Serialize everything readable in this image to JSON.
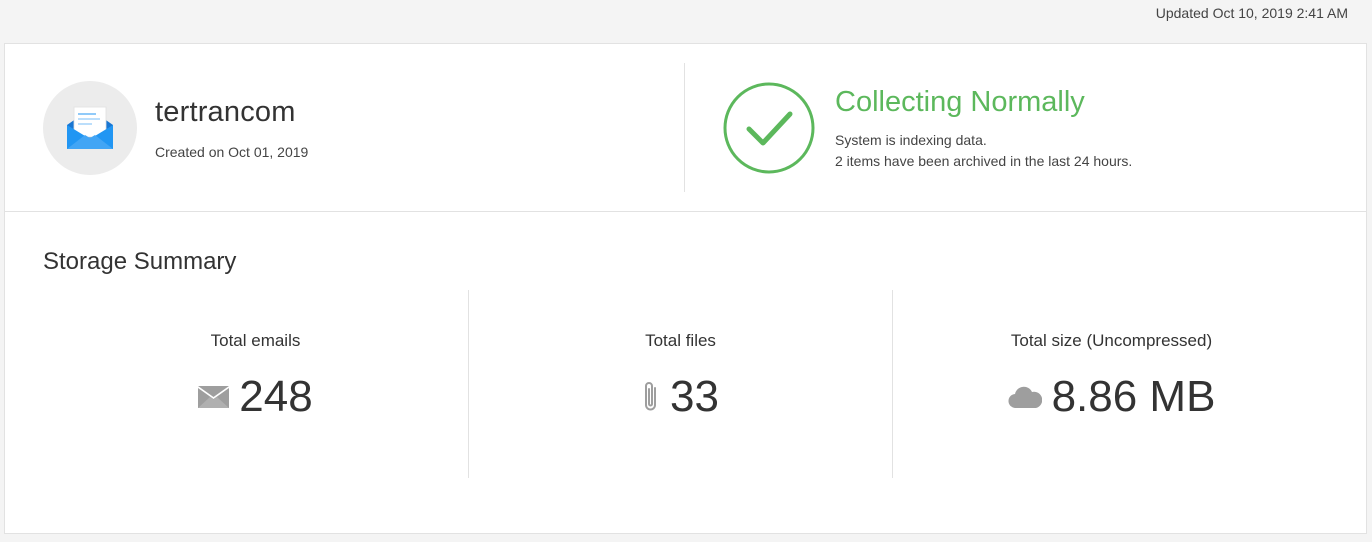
{
  "header": {
    "updated_text": "Updated Oct 10, 2019 2:41 AM"
  },
  "account": {
    "avatar_icon": "open-envelope-icon",
    "name": "tertrancom",
    "created_text": "Created on Oct 01, 2019"
  },
  "status": {
    "icon": "check-circle-icon",
    "title": "Collecting Normally",
    "line1": "System is indexing data.",
    "line2": "2 items have been archived in the last 24 hours.",
    "color": "#5cb85c"
  },
  "storage": {
    "title": "Storage Summary",
    "stats": [
      {
        "label": "Total emails",
        "value": "248",
        "icon": "envelope-icon"
      },
      {
        "label": "Total files",
        "value": "33",
        "icon": "paperclip-icon"
      },
      {
        "label": "Total size (Uncompressed)",
        "value": "8.86 MB",
        "icon": "cloud-icon"
      }
    ]
  },
  "colors": {
    "accent_blue": "#2196f3",
    "success_green": "#5cb85c",
    "icon_gray": "#9e9e9e"
  }
}
